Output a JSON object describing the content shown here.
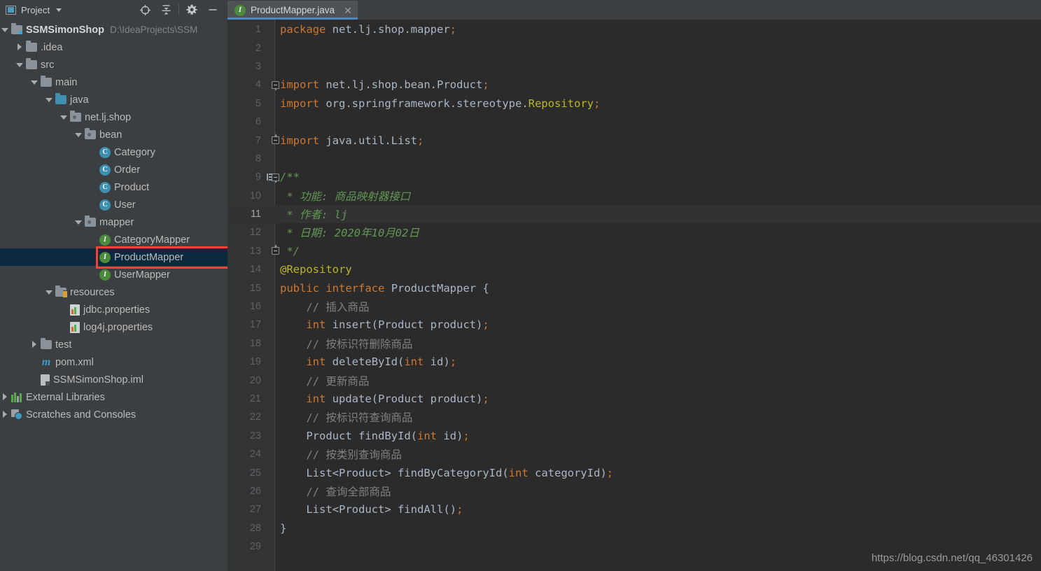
{
  "tool_window": {
    "title": "Project",
    "dropdown_icon": "chevron-down-icon",
    "actions": [
      {
        "name": "select-opened-file-icon",
        "label": "Select Opened File"
      },
      {
        "name": "collapse-all-icon",
        "label": "Collapse All"
      },
      {
        "name": "settings-gear-icon",
        "label": "Settings"
      },
      {
        "name": "hide-icon",
        "label": "Hide"
      }
    ]
  },
  "project_tree": {
    "root": {
      "label": "SSMSimonShop",
      "path_hint": "D:\\IdeaProjects\\SSM"
    },
    "items": [
      {
        "label": ".idea",
        "icon": "folder-icon",
        "indent": 1,
        "arrow": "right",
        "selected": false
      },
      {
        "label": "src",
        "icon": "folder-icon",
        "indent": 1,
        "arrow": "down",
        "selected": false
      },
      {
        "label": "main",
        "icon": "folder-icon",
        "indent": 2,
        "arrow": "down",
        "selected": false
      },
      {
        "label": "java",
        "icon": "source-folder-icon",
        "indent": 3,
        "arrow": "down",
        "selected": false
      },
      {
        "label": "net.lj.shop",
        "icon": "package-icon",
        "indent": 4,
        "arrow": "down",
        "selected": false
      },
      {
        "label": "bean",
        "icon": "package-icon",
        "indent": 5,
        "arrow": "down",
        "selected": false
      },
      {
        "label": "Category",
        "icon": "java-class-icon",
        "indent": 6,
        "arrow": "none",
        "selected": false
      },
      {
        "label": "Order",
        "icon": "java-class-icon",
        "indent": 6,
        "arrow": "none",
        "selected": false
      },
      {
        "label": "Product",
        "icon": "java-class-icon",
        "indent": 6,
        "arrow": "none",
        "selected": false
      },
      {
        "label": "User",
        "icon": "java-class-icon",
        "indent": 6,
        "arrow": "none",
        "selected": false
      },
      {
        "label": "mapper",
        "icon": "package-icon",
        "indent": 5,
        "arrow": "down",
        "selected": false
      },
      {
        "label": "CategoryMapper",
        "icon": "java-interface-icon",
        "indent": 6,
        "arrow": "none",
        "selected": false
      },
      {
        "label": "ProductMapper",
        "icon": "java-interface-icon",
        "indent": 6,
        "arrow": "none",
        "selected": true
      },
      {
        "label": "UserMapper",
        "icon": "java-interface-icon",
        "indent": 6,
        "arrow": "none",
        "selected": false
      },
      {
        "label": "resources",
        "icon": "resources-folder-icon",
        "indent": 3,
        "arrow": "down",
        "selected": false
      },
      {
        "label": "jdbc.properties",
        "icon": "properties-file-icon",
        "indent": 4,
        "arrow": "none",
        "selected": false
      },
      {
        "label": "log4j.properties",
        "icon": "properties-file-icon",
        "indent": 4,
        "arrow": "none",
        "selected": false
      },
      {
        "label": "test",
        "icon": "folder-icon",
        "indent": 2,
        "arrow": "right",
        "selected": false
      },
      {
        "label": "pom.xml",
        "icon": "maven-icon",
        "indent": 2,
        "arrow": "none",
        "selected": false
      },
      {
        "label": "SSMSimonShop.iml",
        "icon": "iml-file-icon",
        "indent": 2,
        "arrow": "none",
        "selected": false
      },
      {
        "label": "External Libraries",
        "icon": "libraries-icon",
        "indent": 0,
        "arrow": "right",
        "selected": false
      },
      {
        "label": "Scratches and Consoles",
        "icon": "scratches-icon",
        "indent": 0,
        "arrow": "right",
        "selected": false
      }
    ]
  },
  "annotation": {
    "type": "red-highlight-rectangle",
    "target": "ProductMapper",
    "color": "#f44336"
  },
  "editor": {
    "tabs": [
      {
        "label": "ProductMapper.java",
        "icon": "java-interface-icon",
        "active": true,
        "close_icon": "close-icon"
      }
    ],
    "caret_line": 11,
    "lines": [
      {
        "n": 1,
        "fold": "",
        "jdoc": false,
        "indent": 0,
        "tokens": [
          {
            "t": "package",
            "c": "kw"
          },
          {
            "t": " ",
            "c": "plain"
          },
          {
            "t": "net.lj.shop.mapper",
            "c": "plain"
          },
          {
            "t": ";",
            "c": "sem"
          }
        ]
      },
      {
        "n": 2,
        "fold": "",
        "jdoc": false,
        "indent": 0,
        "tokens": []
      },
      {
        "n": 3,
        "fold": "",
        "jdoc": false,
        "indent": 0,
        "tokens": []
      },
      {
        "n": 4,
        "fold": "open",
        "jdoc": false,
        "indent": 0,
        "tokens": [
          {
            "t": "import",
            "c": "kw"
          },
          {
            "t": " ",
            "c": "plain"
          },
          {
            "t": "net.lj.shop.bean.Product",
            "c": "plain"
          },
          {
            "t": ";",
            "c": "sem"
          }
        ]
      },
      {
        "n": 5,
        "fold": "",
        "jdoc": false,
        "indent": 0,
        "tokens": [
          {
            "t": "import",
            "c": "kw"
          },
          {
            "t": " ",
            "c": "plain"
          },
          {
            "t": "org.springframework.stereotype.",
            "c": "plain"
          },
          {
            "t": "Repository",
            "c": "anno"
          },
          {
            "t": ";",
            "c": "sem"
          }
        ]
      },
      {
        "n": 6,
        "fold": "",
        "jdoc": false,
        "indent": 0,
        "tokens": []
      },
      {
        "n": 7,
        "fold": "close",
        "jdoc": false,
        "indent": 0,
        "tokens": [
          {
            "t": "import",
            "c": "kw"
          },
          {
            "t": " ",
            "c": "plain"
          },
          {
            "t": "java.util.List",
            "c": "plain"
          },
          {
            "t": ";",
            "c": "sem"
          }
        ]
      },
      {
        "n": 8,
        "fold": "",
        "jdoc": false,
        "indent": 0,
        "tokens": []
      },
      {
        "n": 9,
        "fold": "open",
        "jdoc": true,
        "indent": 0,
        "tokens": [
          {
            "t": "/**",
            "c": "jdoc"
          }
        ]
      },
      {
        "n": 10,
        "fold": "",
        "jdoc": false,
        "indent": 0,
        "tokens": [
          {
            "t": " * 功能: 商品映射器接口",
            "c": "jdoc"
          }
        ]
      },
      {
        "n": 11,
        "fold": "",
        "jdoc": false,
        "indent": 0,
        "tokens": [
          {
            "t": " * 作者: lj",
            "c": "jdoc"
          }
        ]
      },
      {
        "n": 12,
        "fold": "",
        "jdoc": false,
        "indent": 0,
        "tokens": [
          {
            "t": " * 日期: 2020年10月02日",
            "c": "jdoc"
          }
        ]
      },
      {
        "n": 13,
        "fold": "close",
        "jdoc": false,
        "indent": 0,
        "tokens": [
          {
            "t": " */",
            "c": "jdoc"
          }
        ]
      },
      {
        "n": 14,
        "fold": "",
        "jdoc": false,
        "indent": 0,
        "tokens": [
          {
            "t": "@Repository",
            "c": "anno"
          }
        ]
      },
      {
        "n": 15,
        "fold": "",
        "jdoc": false,
        "indent": 0,
        "tokens": [
          {
            "t": "public",
            "c": "kw"
          },
          {
            "t": " ",
            "c": "plain"
          },
          {
            "t": "interface",
            "c": "kw"
          },
          {
            "t": " ",
            "c": "plain"
          },
          {
            "t": "ProductMapper",
            "c": "plain"
          },
          {
            "t": " {",
            "c": "punc"
          }
        ]
      },
      {
        "n": 16,
        "fold": "",
        "jdoc": false,
        "indent": 0,
        "tokens": [
          {
            "t": "    // 插入商品",
            "c": "cmt"
          }
        ]
      },
      {
        "n": 17,
        "fold": "",
        "jdoc": false,
        "indent": 0,
        "tokens": [
          {
            "t": "    ",
            "c": "plain"
          },
          {
            "t": "int",
            "c": "kw"
          },
          {
            "t": " ",
            "c": "plain"
          },
          {
            "t": "insert",
            "c": "plain"
          },
          {
            "t": "(",
            "c": "punc"
          },
          {
            "t": "Product",
            "c": "plain"
          },
          {
            "t": " product",
            "c": "plain"
          },
          {
            "t": ")",
            "c": "punc"
          },
          {
            "t": ";",
            "c": "sem"
          }
        ]
      },
      {
        "n": 18,
        "fold": "",
        "jdoc": false,
        "indent": 0,
        "tokens": [
          {
            "t": "    // 按标识符删除商品",
            "c": "cmt"
          }
        ]
      },
      {
        "n": 19,
        "fold": "",
        "jdoc": false,
        "indent": 0,
        "tokens": [
          {
            "t": "    ",
            "c": "plain"
          },
          {
            "t": "int",
            "c": "kw"
          },
          {
            "t": " ",
            "c": "plain"
          },
          {
            "t": "deleteById",
            "c": "plain"
          },
          {
            "t": "(",
            "c": "punc"
          },
          {
            "t": "int",
            "c": "kw"
          },
          {
            "t": " id",
            "c": "plain"
          },
          {
            "t": ")",
            "c": "punc"
          },
          {
            "t": ";",
            "c": "sem"
          }
        ]
      },
      {
        "n": 20,
        "fold": "",
        "jdoc": false,
        "indent": 0,
        "tokens": [
          {
            "t": "    // 更新商品",
            "c": "cmt"
          }
        ]
      },
      {
        "n": 21,
        "fold": "",
        "jdoc": false,
        "indent": 0,
        "tokens": [
          {
            "t": "    ",
            "c": "plain"
          },
          {
            "t": "int",
            "c": "kw"
          },
          {
            "t": " ",
            "c": "plain"
          },
          {
            "t": "update",
            "c": "plain"
          },
          {
            "t": "(",
            "c": "punc"
          },
          {
            "t": "Product",
            "c": "plain"
          },
          {
            "t": " product",
            "c": "plain"
          },
          {
            "t": ")",
            "c": "punc"
          },
          {
            "t": ";",
            "c": "sem"
          }
        ]
      },
      {
        "n": 22,
        "fold": "",
        "jdoc": false,
        "indent": 0,
        "tokens": [
          {
            "t": "    // 按标识符查询商品",
            "c": "cmt"
          }
        ]
      },
      {
        "n": 23,
        "fold": "",
        "jdoc": false,
        "indent": 0,
        "tokens": [
          {
            "t": "    ",
            "c": "plain"
          },
          {
            "t": "Product",
            "c": "plain"
          },
          {
            "t": " ",
            "c": "plain"
          },
          {
            "t": "findById",
            "c": "plain"
          },
          {
            "t": "(",
            "c": "punc"
          },
          {
            "t": "int",
            "c": "kw"
          },
          {
            "t": " id",
            "c": "plain"
          },
          {
            "t": ")",
            "c": "punc"
          },
          {
            "t": ";",
            "c": "sem"
          }
        ]
      },
      {
        "n": 24,
        "fold": "",
        "jdoc": false,
        "indent": 0,
        "tokens": [
          {
            "t": "    // 按类别查询商品",
            "c": "cmt"
          }
        ]
      },
      {
        "n": 25,
        "fold": "",
        "jdoc": false,
        "indent": 0,
        "tokens": [
          {
            "t": "    ",
            "c": "plain"
          },
          {
            "t": "List<Product>",
            "c": "plain"
          },
          {
            "t": " ",
            "c": "plain"
          },
          {
            "t": "findByCategoryId",
            "c": "plain"
          },
          {
            "t": "(",
            "c": "punc"
          },
          {
            "t": "int",
            "c": "kw"
          },
          {
            "t": " categoryId",
            "c": "plain"
          },
          {
            "t": ")",
            "c": "punc"
          },
          {
            "t": ";",
            "c": "sem"
          }
        ]
      },
      {
        "n": 26,
        "fold": "",
        "jdoc": false,
        "indent": 0,
        "tokens": [
          {
            "t": "    // 查询全部商品",
            "c": "cmt"
          }
        ]
      },
      {
        "n": 27,
        "fold": "",
        "jdoc": false,
        "indent": 0,
        "tokens": [
          {
            "t": "    ",
            "c": "plain"
          },
          {
            "t": "List<Product>",
            "c": "plain"
          },
          {
            "t": " ",
            "c": "plain"
          },
          {
            "t": "findAll",
            "c": "plain"
          },
          {
            "t": "()",
            "c": "punc"
          },
          {
            "t": ";",
            "c": "sem"
          }
        ]
      },
      {
        "n": 28,
        "fold": "",
        "jdoc": false,
        "indent": 0,
        "tokens": [
          {
            "t": "}",
            "c": "punc"
          }
        ]
      },
      {
        "n": 29,
        "fold": "",
        "jdoc": false,
        "indent": 0,
        "tokens": []
      }
    ]
  },
  "watermark": "https://blog.csdn.net/qq_46301426",
  "colors": {
    "panel_bg": "#3c3f41",
    "editor_bg": "#2b2b2b",
    "gutter_bg": "#313335",
    "selection_bg": "#0d293e",
    "caret_line_bg": "#323232",
    "tab_active_underline": "#4a88c7",
    "keyword": "#cc7832",
    "annotation_text": "#bbb529",
    "javadoc": "#629755",
    "comment": "#808080",
    "identifier": "#a9b7c6",
    "highlight_rect": "#f44336"
  }
}
